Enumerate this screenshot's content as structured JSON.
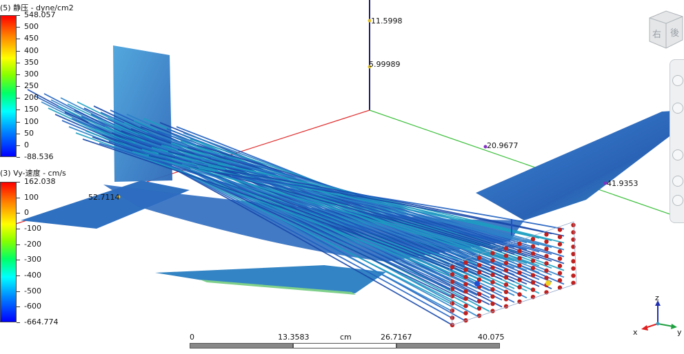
{
  "legend_pressure": {
    "title": "(5) 静压 - dyne/cm2",
    "ticks": [
      "548.057",
      "500",
      "450",
      "400",
      "350",
      "300",
      "250",
      "200",
      "150",
      "100",
      "50",
      "0",
      "-88.536"
    ]
  },
  "legend_velocity": {
    "title": "(3) Vy-速度 - cm/s",
    "ticks": [
      "162.038",
      "100",
      "0",
      "-100",
      "-200",
      "-300",
      "-400",
      "-500",
      "-600",
      "-664.774"
    ]
  },
  "axis_labels": {
    "z1": "11.5998",
    "z2": "5.99989",
    "y1": "20.9677",
    "y2": "41.9353",
    "x1": "52.7114"
  },
  "scale_bar": {
    "v0": "0",
    "v1": "13.3583",
    "unit": "cm",
    "v2": "26.7167",
    "v3": "40.075"
  },
  "nav_cube": {
    "face_right": "右",
    "face_back": "後"
  },
  "triad": {
    "x": "x",
    "y": "y",
    "z": "z"
  },
  "colors": {
    "model_blue": "#2d6fc2",
    "streamline_blue": "#1a4fb0",
    "seed_red": "#c0201e",
    "axis_red": "#e03030",
    "axis_green": "#40c040",
    "axis_navy": "#1a1a70"
  },
  "icons": [
    "nav-cube-icon",
    "zoom-icon",
    "pan-icon",
    "rotate-icon",
    "print-icon",
    "save-icon",
    "coordinate-triad-icon"
  ]
}
